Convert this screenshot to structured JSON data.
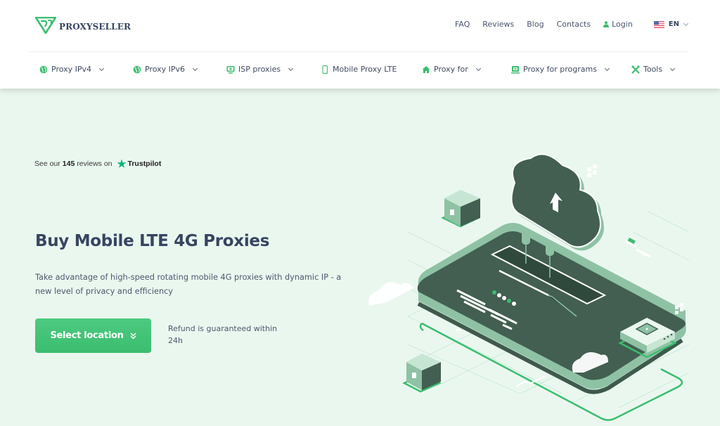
{
  "brand": {
    "name": "PROXYSELLER",
    "accent": "#3bbd6f",
    "dark": "#374561"
  },
  "toplinks": {
    "faq": "FAQ",
    "reviews": "Reviews",
    "blog": "Blog",
    "contacts": "Contacts",
    "login": "Login",
    "language": "EN"
  },
  "nav": [
    {
      "label": "Proxy IPv4",
      "icon": "globe-icon",
      "dropdown": true
    },
    {
      "label": "Proxy IPv6",
      "icon": "globe-icon",
      "dropdown": true
    },
    {
      "label": "ISP proxies",
      "icon": "monitor-icon",
      "dropdown": true
    },
    {
      "label": "Mobile Proxy LTE",
      "icon": "phone-icon",
      "dropdown": false
    },
    {
      "label": "Proxy for",
      "icon": "house-icon",
      "dropdown": true
    },
    {
      "label": "Proxy for programs",
      "icon": "program-icon",
      "dropdown": true
    },
    {
      "label": "Tools",
      "icon": "tools-icon",
      "dropdown": true
    }
  ],
  "trust": {
    "prefix": "See our",
    "count": "145",
    "suffix": "reviews on",
    "platform": "Trustpilot"
  },
  "hero": {
    "title": "Buy Mobile LTE 4G Proxies",
    "subtitle": "Take advantage of high-speed rotating mobile 4G proxies with dynamic IP - a new level of privacy and efficiency",
    "cta": "Select location",
    "refund": "Refund is guaranteed within 24h"
  }
}
